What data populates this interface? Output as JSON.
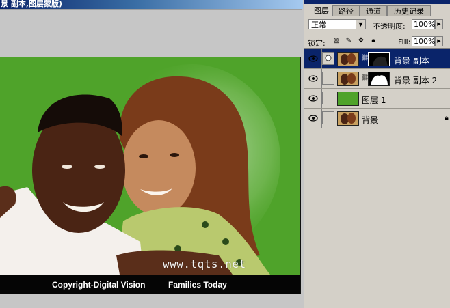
{
  "document": {
    "title": "景 副本,图层蒙版)",
    "watermark": "www.tqts.net",
    "caption_left": "Copyright-Digital Vision",
    "caption_right": "Families Today",
    "canvas_color": "#4fa32a"
  },
  "panel": {
    "tabs": [
      {
        "label": "图层",
        "active": true
      },
      {
        "label": "路径",
        "active": false
      },
      {
        "label": "通道",
        "active": false
      },
      {
        "label": "历史记录",
        "active": false
      }
    ],
    "blend_mode": "正常",
    "opacity_label": "不透明度:",
    "opacity_value": "100%",
    "lock_label": "锁定:",
    "fill_label": "Fill:",
    "fill_value": "100%",
    "layers": [
      {
        "name": "背景 副本",
        "selected": true,
        "has_mask": true,
        "mask_icon": "dark-mask-icon",
        "thumb": "photo-thumb"
      },
      {
        "name": "背景 副本 2",
        "selected": false,
        "has_mask": true,
        "mask_icon": "silhouette-mask-icon",
        "thumb": "photo-thumb"
      },
      {
        "name": "图层 1",
        "selected": false,
        "has_mask": false,
        "thumb": "green-fill-thumb"
      },
      {
        "name": "背景",
        "selected": false,
        "has_mask": false,
        "thumb": "photo-thumb",
        "locked": true
      }
    ]
  },
  "colors": {
    "titlebar_start": "#0a246a",
    "selected_row": "#0a246a",
    "panel_bg": "#d4d0c8",
    "workspace_bg": "#c6c6c6"
  }
}
